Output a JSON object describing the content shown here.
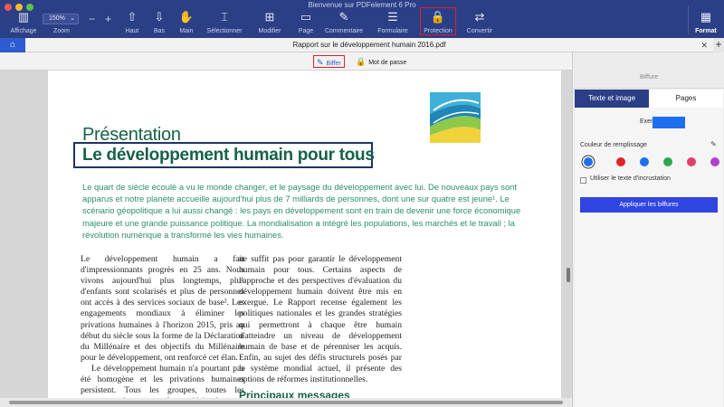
{
  "window": {
    "title": "Bienvenue sur PDFelement 6 Pro"
  },
  "toolbar": {
    "zoom_value": "150%",
    "items": [
      {
        "label": "Affichage",
        "icon": "sidebar-icon"
      },
      {
        "label": "Zoom",
        "icon": "zoom-icon"
      },
      {
        "label": "Haut",
        "icon": "page-up-icon"
      },
      {
        "label": "Bas",
        "icon": "page-down-icon"
      },
      {
        "label": "Main",
        "icon": "hand-icon"
      },
      {
        "label": "Sélectionner",
        "icon": "cursor-icon"
      },
      {
        "label": "Modifier",
        "icon": "edit-icon"
      },
      {
        "label": "Page",
        "icon": "page-icon"
      },
      {
        "label": "Commentaire",
        "icon": "comment-icon"
      },
      {
        "label": "Formulaire",
        "icon": "form-icon"
      },
      {
        "label": "Protection",
        "icon": "lock-icon"
      },
      {
        "label": "Convertir",
        "icon": "convert-icon"
      },
      {
        "label": "Format",
        "icon": "format-icon"
      }
    ]
  },
  "tabs": {
    "doc_title": "Rapport sur le développement humain 2016.pdf"
  },
  "subtoolbar": {
    "redact_label": "Biffer",
    "password_label": "Mot de passe"
  },
  "document": {
    "heading_small": "Présentation",
    "heading_main": "Le développement humain pour tous",
    "intro": "Le quart de siècle écoulé a vu le monde changer, et le paysage du développement avec lui. De nouveaux pays sont apparus et notre planète accueille aujourd'hui plus de 7 milliards de personnes, dont une sur quatre est jeune¹. Le scénario géopolitique a lui aussi changé : les pays en développement sont en train de devenir une force économique majeure et une grande puissance politique. La mondialisation a intégré les populations, les marchés et le travail ; la révolution numérique a transformé les vies humaines.",
    "col1_p1": "Le développement humain a fait d'impressionnants progrès en 25 ans. Nous vivons aujourd'hui plus longtemps, plus d'enfants sont scolarisés et plus de personnes ont accès à des services sociaux de base². Les engagements mondiaux à éliminer les privations humaines à l'horizon 2015, pris au début du siècle sous la forme de la Déclaration du Millénaire et des objectifs du Millénaire pour le développement, ont renforcé cet élan.",
    "col1_p2": "Le développement humain n'a pourtant pas été homogène et les privations humaines persistent. Tous les groupes, toutes les communautés et toutes les sociétés n'ont pas bénéficié des avancées, qui ont parfois fait des",
    "col2_p1": "ne suffit pas pour garantir le développement humain pour tous. Certains aspects de l'approche et des perspectives d'évaluation du développement humain doivent être mis en exergue. Le Rapport recense également les politiques nationales et les grandes stratégies qui permettront à chaque être humain d'atteindre un niveau de développement humain de base et de pérenniser les acquis. Enfin, au sujet des défis structurels posés par le système mondial actuel, il présente des options de réformes institutionnelles.",
    "subheading": "Principaux messages"
  },
  "panel": {
    "title": "Biffure",
    "tab_text_image": "Texte et image",
    "tab_pages": "Pages",
    "example_label": "Exen",
    "fill_color_label": "Couleur de remplissage",
    "overlay_text_label": "Utiliser le texte d'incrustation",
    "apply_button": "Appliquer les biffures",
    "swatches": [
      "#1e6ff0",
      "#e02424",
      "#1e6ff0",
      "#2ea84a",
      "#e0406a",
      "#b040d0",
      "#e08a1e"
    ]
  }
}
